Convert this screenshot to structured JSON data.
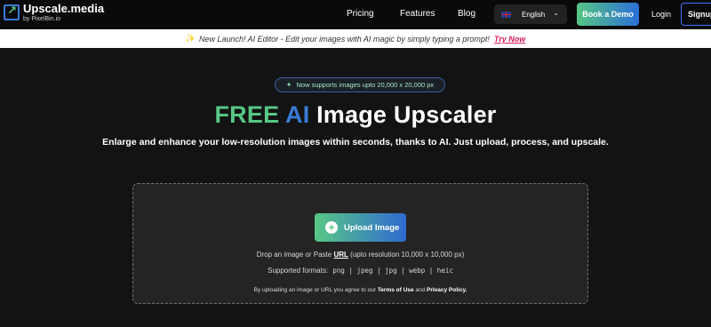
{
  "navbar": {
    "logo_name": "Upscale.media",
    "logo_by": "by PixelBin.io",
    "links": [
      "Pricing",
      "Features",
      "Blog"
    ],
    "language": "English",
    "demo_label": "Book a Demo",
    "login_label": "Login",
    "signup_label": "Signup"
  },
  "announcement": {
    "text": "New Launch! AI Editor - Edit your images with AI magic by simply typing a prompt!",
    "cta": "Try Now"
  },
  "hero": {
    "pill_text": "Now supports images upto 20,000 x 20,000 px",
    "title_free": "FREE",
    "title_ai": "AI",
    "title_rest": "Image Upscaler",
    "subtitle": "Enlarge and enhance your low-resolution images within seconds, thanks to AI. Just upload, process, and upscale."
  },
  "upload": {
    "button_label": "Upload Image",
    "drop_prefix": "Drop an image or Paste",
    "drop_url": "URL",
    "drop_suffix": "(upto resolution 10,000 x 10,000 px)",
    "formats_label": "Supported formats:",
    "formats_list": "png | jpeg | jpg | webp | heic",
    "terms_prefix": "By uploading an image or URL you agree to our",
    "terms_link": "Terms of Use",
    "terms_and": "and",
    "privacy_link": "Privacy Policy."
  },
  "colors": {
    "accent_green": "#57c785",
    "accent_blue": "#3a7bd5",
    "cta_pink": "#d81b60"
  },
  "icons": [
    "logo-arrow-icon",
    "uk-flag-icon",
    "chevron-down-icon",
    "sparkle-icon",
    "plus-icon"
  ]
}
